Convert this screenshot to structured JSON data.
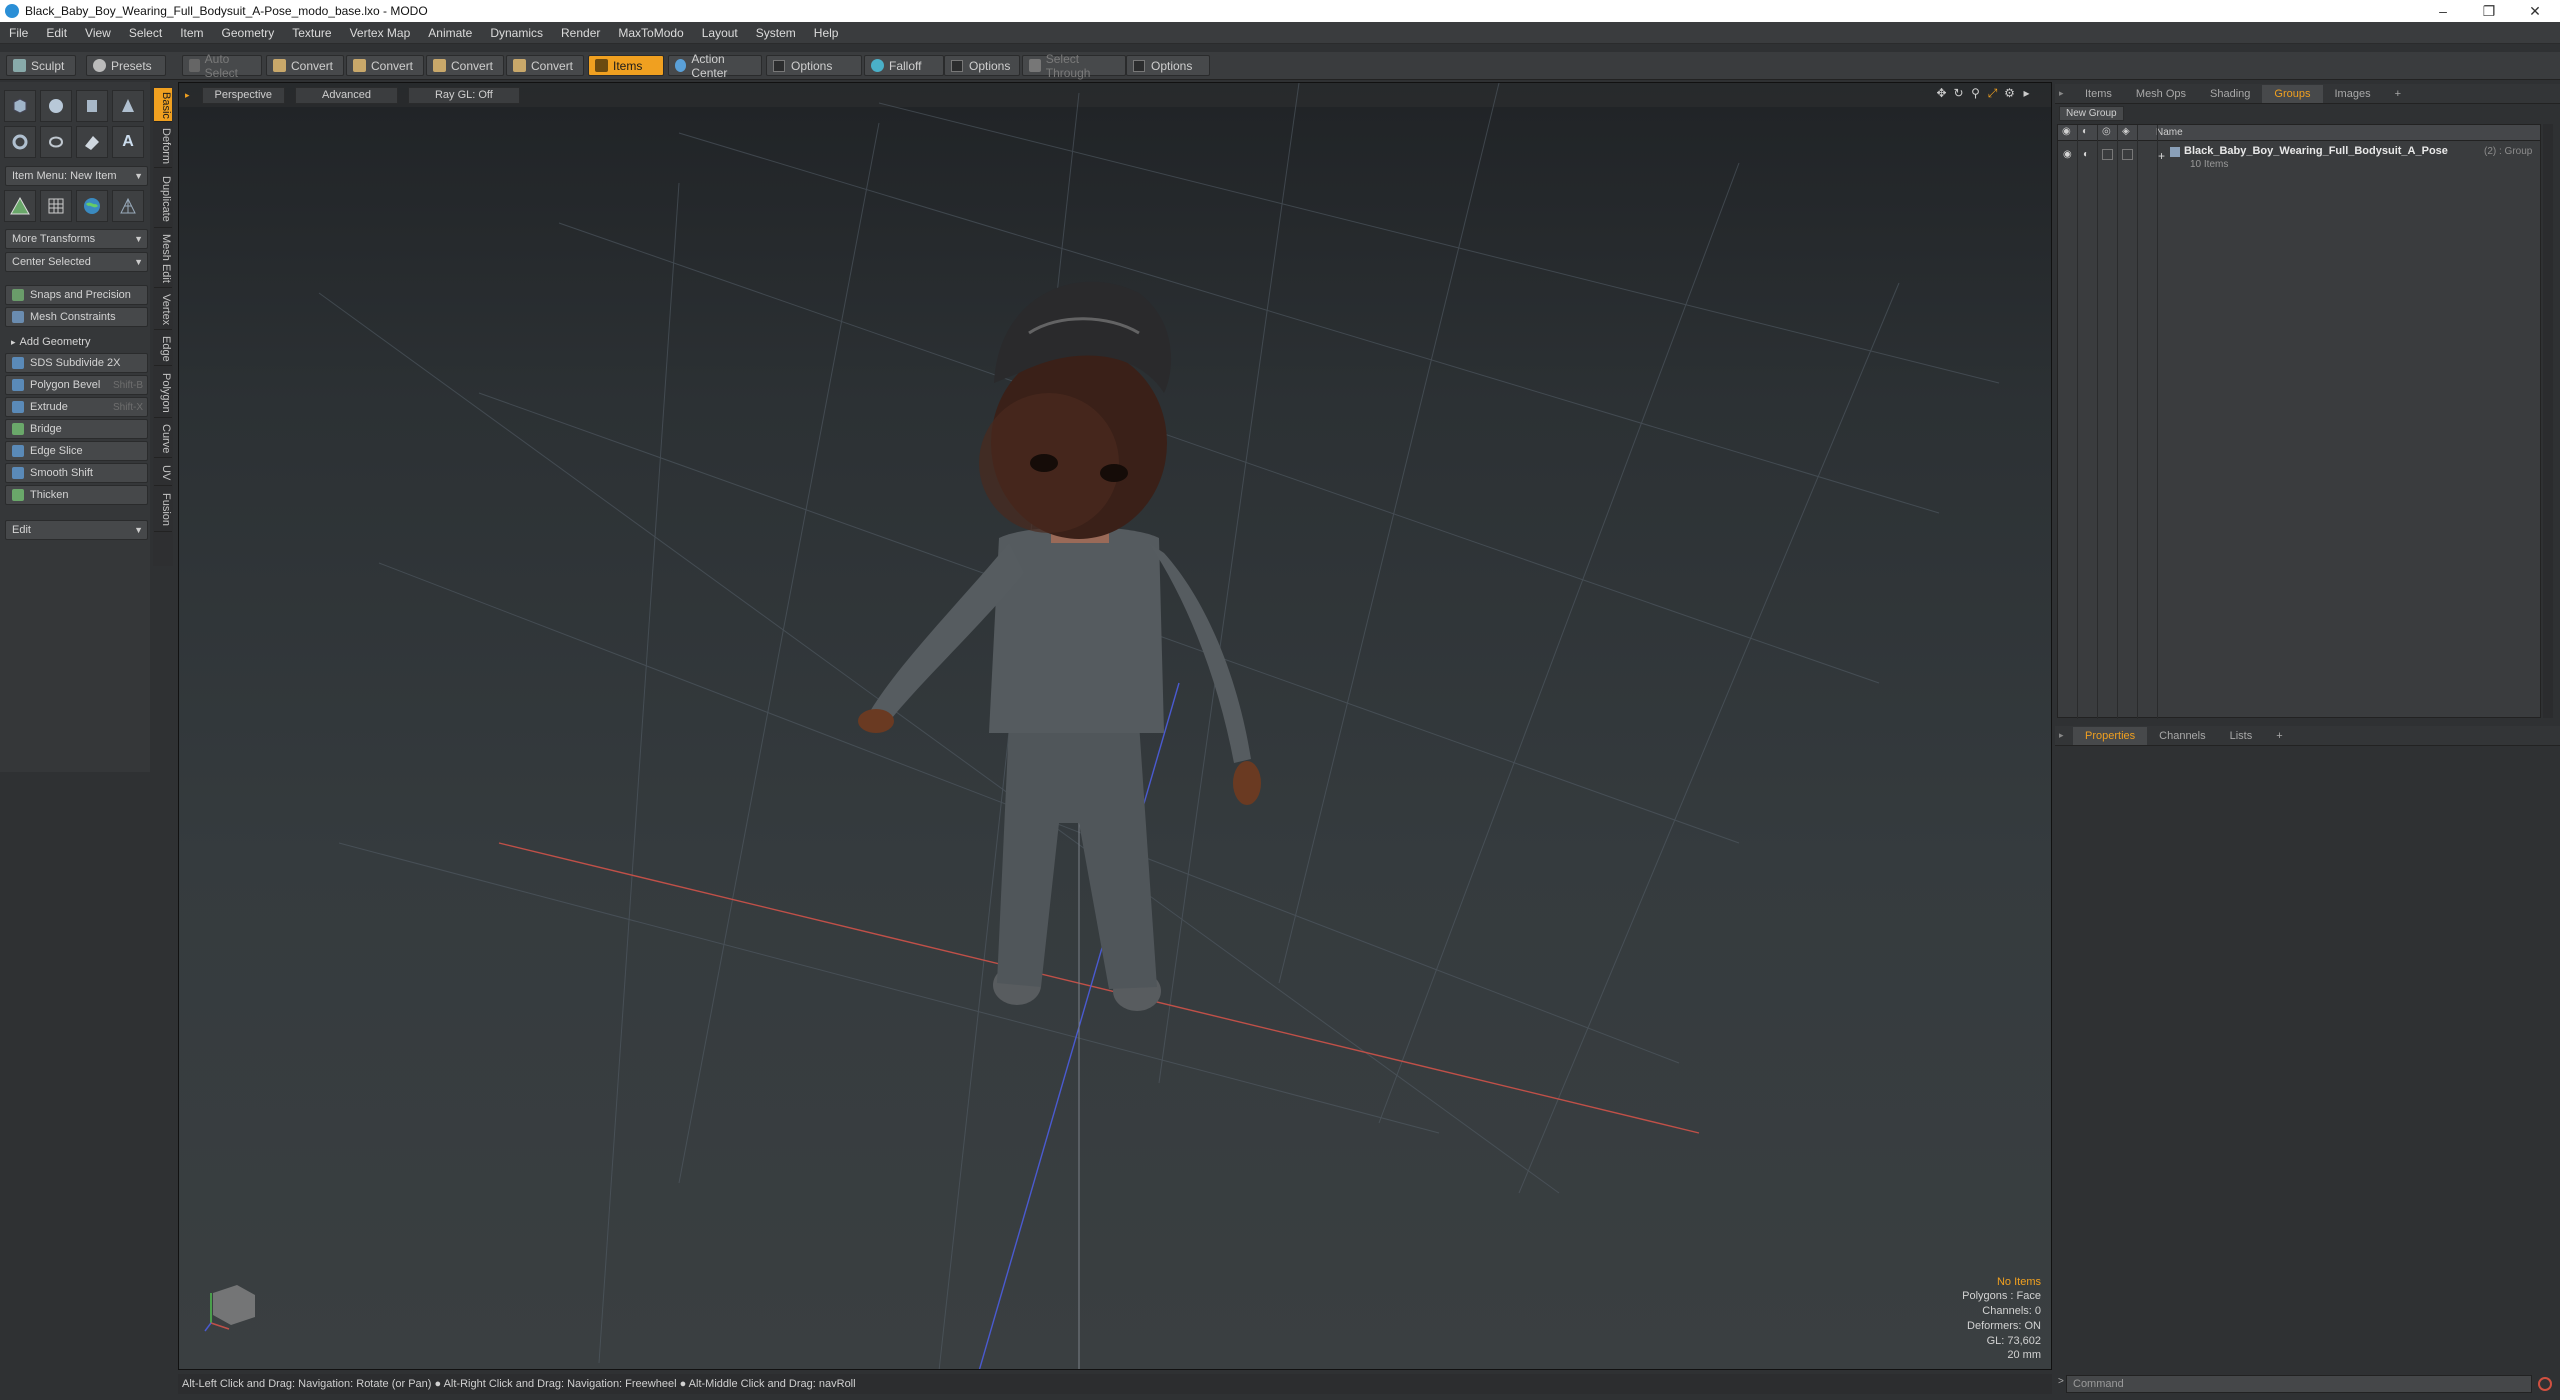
{
  "window": {
    "title": "Black_Baby_Boy_Wearing_Full_Bodysuit_A-Pose_modo_base.lxo - MODO"
  },
  "menu": [
    "File",
    "Edit",
    "View",
    "Select",
    "Item",
    "Geometry",
    "Texture",
    "Vertex Map",
    "Animate",
    "Dynamics",
    "Render",
    "MaxToModo",
    "Layout",
    "System",
    "Help"
  ],
  "toolbar": {
    "sculpt": "Sculpt",
    "presets": "Presets",
    "auto_select": "Auto Select",
    "convert1": "Convert",
    "convert2": "Convert",
    "convert3": "Convert",
    "convert4": "Convert",
    "items": "Items",
    "action_center": "Action Center",
    "options1": "Options",
    "falloff": "Falloff",
    "options2": "Options",
    "select_through": "Select Through",
    "options3": "Options"
  },
  "left": {
    "item_menu": "Item Menu: New Item",
    "more_transforms": "More Transforms",
    "center_selected": "Center Selected",
    "snaps": "Snaps and Precision",
    "mesh_constraints": "Mesh Constraints",
    "add_geometry": "Add Geometry",
    "tools": [
      {
        "label": "SDS Subdivide 2X",
        "shortcut": ""
      },
      {
        "label": "Polygon Bevel",
        "shortcut": "Shift-B"
      },
      {
        "label": "Extrude",
        "shortcut": "Shift-X"
      },
      {
        "label": "Bridge",
        "shortcut": ""
      },
      {
        "label": "Edge Slice",
        "shortcut": ""
      },
      {
        "label": "Smooth Shift",
        "shortcut": ""
      },
      {
        "label": "Thicken",
        "shortcut": ""
      }
    ],
    "edit": "Edit",
    "vtabs": [
      "Basic",
      "Deform",
      "Duplicate",
      "Mesh Edit",
      "Vertex",
      "Edge",
      "Polygon",
      "Curve",
      "UV",
      "Fusion"
    ]
  },
  "viewport": {
    "perspective": "Perspective",
    "advanced": "Advanced",
    "raygl": "Ray GL: Off",
    "stats": {
      "items": "No Items",
      "polygons": "Polygons : Face",
      "channels": "Channels: 0",
      "deformers": "Deformers: ON",
      "gl": "GL: 73,602",
      "size": "20 mm"
    }
  },
  "statusbar": "Alt-Left Click and Drag: Navigation: Rotate (or Pan) ● Alt-Right Click and Drag: Navigation: Freewheel ● Alt-Middle Click and Drag: navRoll",
  "right": {
    "top_tabs": [
      "Items",
      "Mesh Ops",
      "Shading",
      "Groups",
      "Images",
      "+"
    ],
    "new_group": "New Group",
    "name_col": "Name",
    "group_name": "Black_Baby_Boy_Wearing_Full_Bodysuit_A_Pose",
    "group_suffix": "(2) : Group",
    "group_items": "10 Items",
    "bottom_tabs": [
      "Properties",
      "Channels",
      "Lists",
      "+"
    ],
    "command_placeholder": "Command"
  }
}
